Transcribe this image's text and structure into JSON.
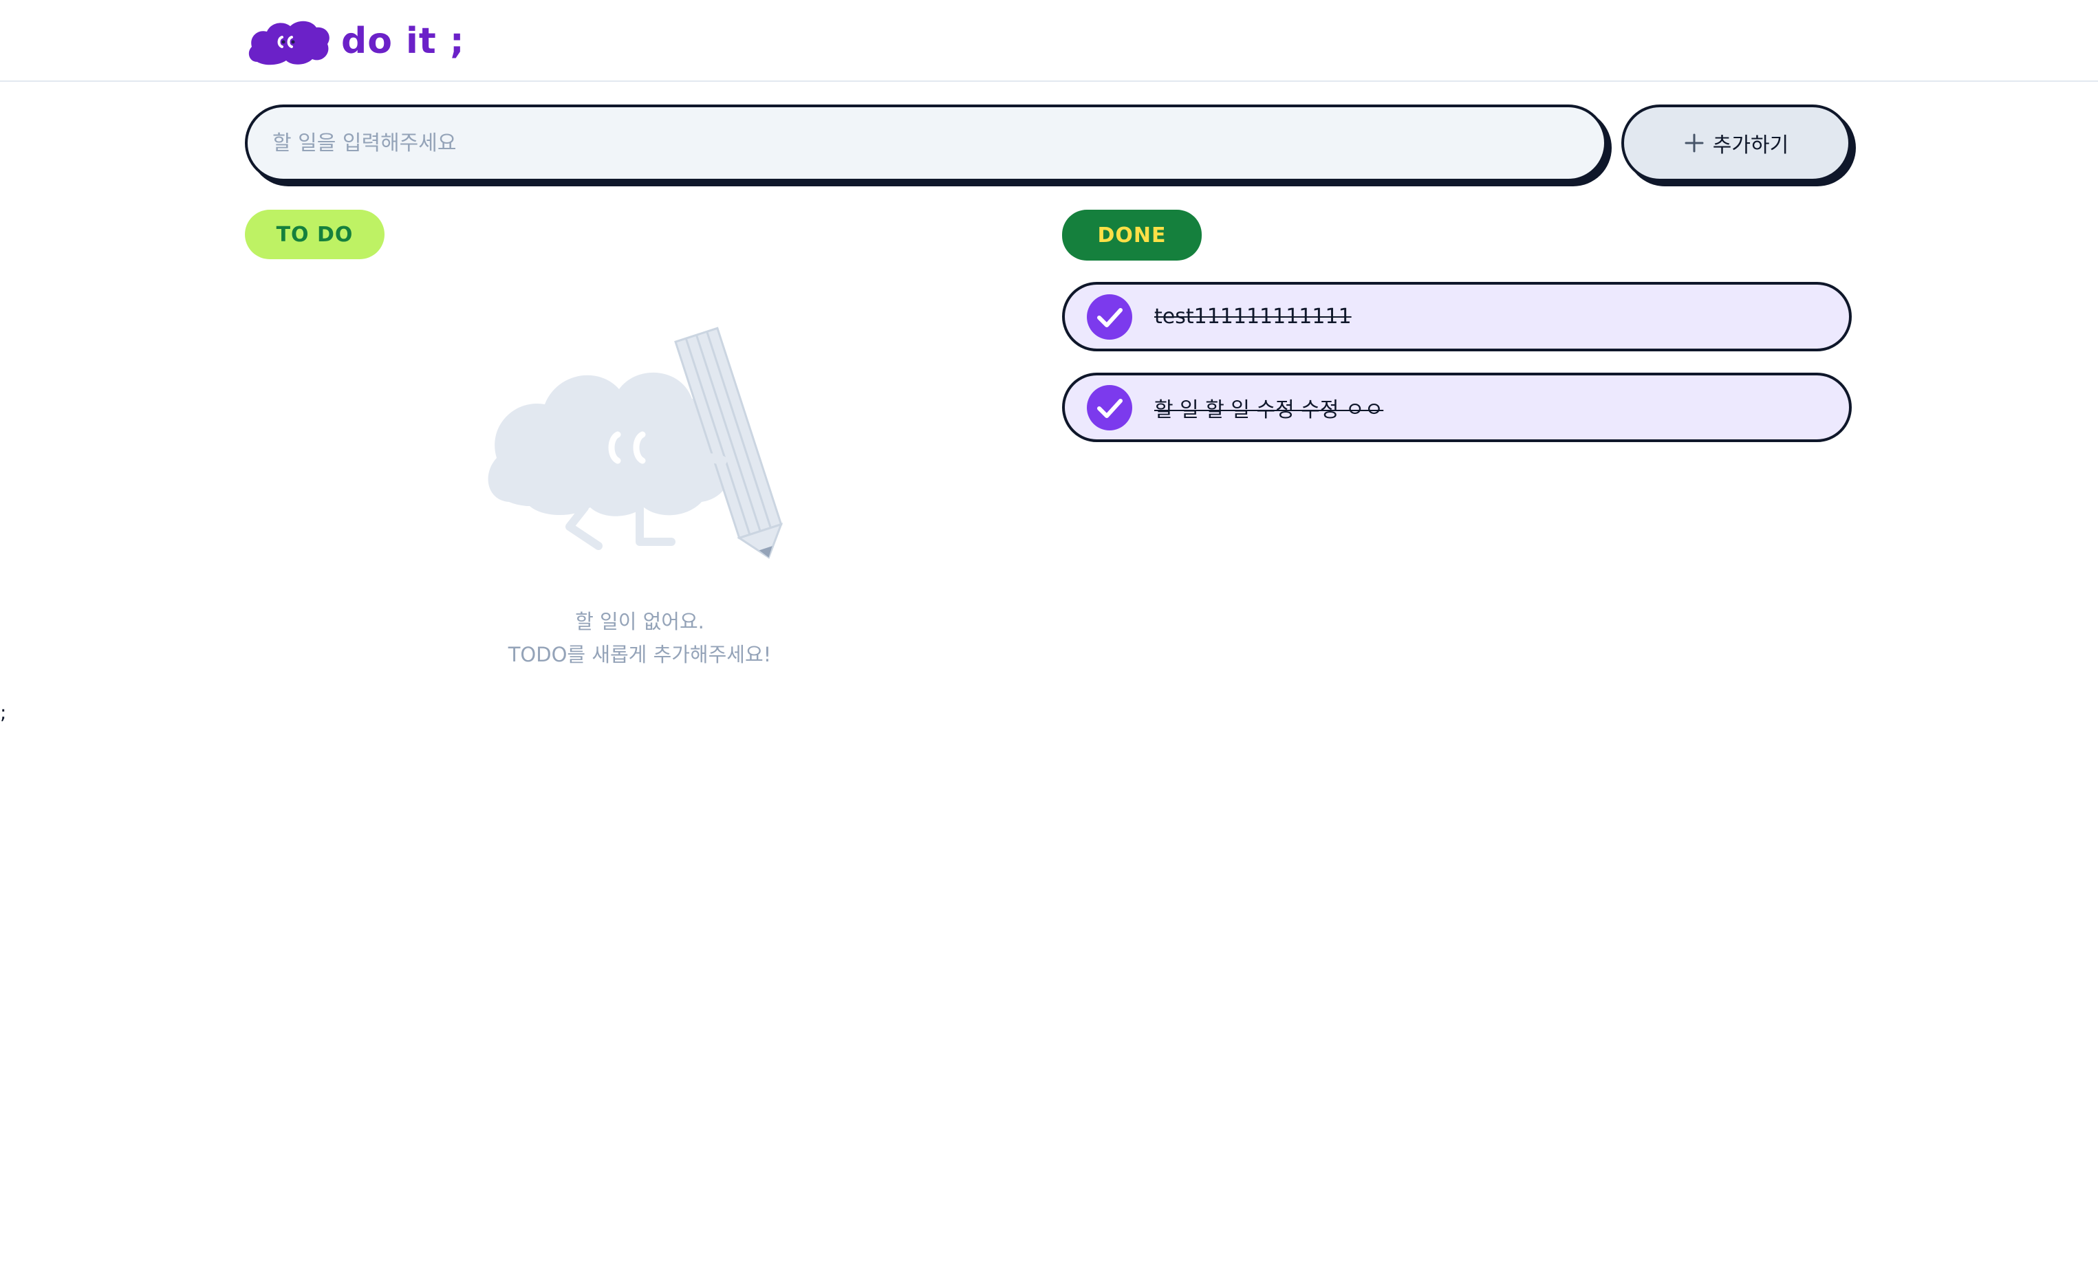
{
  "header": {
    "logo_text": "do it ;",
    "logo_icon": "cloud-mascot-icon",
    "brand_color": "#6b21c8"
  },
  "search": {
    "placeholder": "할 일을 입력해주세요",
    "value": ""
  },
  "add_button": {
    "label": "추가하기",
    "icon": "plus-icon"
  },
  "todo_section": {
    "badge": "TO DO",
    "badge_color": "#bef264",
    "empty_line1": "할 일이 없어요.",
    "empty_line2": "TODO를 새롭게 추가해주세요!",
    "empty_icon": "cloud-pencil-mascot-icon"
  },
  "done_section": {
    "badge": "DONE",
    "badge_color": "#15803d",
    "items": [
      {
        "label": "test111111111111",
        "checked": true
      },
      {
        "label": "할 일 할 일 수정 수정 ㅇㅇ",
        "checked": true
      }
    ]
  },
  "stray_text": ";",
  "colors": {
    "checked": "#7c3aed",
    "done_item_bg": "#ede9fe",
    "outline": "#0f172a"
  }
}
